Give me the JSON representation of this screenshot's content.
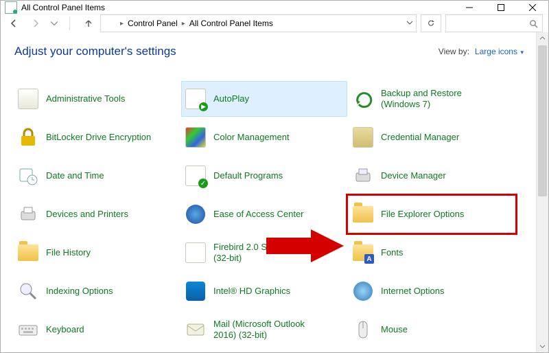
{
  "window": {
    "title": "All Control Panel Items"
  },
  "breadcrumbs": {
    "root": "Control Panel",
    "current": "All Control Panel Items"
  },
  "heading": "Adjust your computer's settings",
  "viewby": {
    "label": "View by:",
    "value": "Large icons"
  },
  "items": [
    {
      "label": "Administrative Tools",
      "icon": "admin-tools-icon"
    },
    {
      "label": "AutoPlay",
      "icon": "autoplay-icon",
      "selected": true
    },
    {
      "label": "Backup and Restore (Windows 7)",
      "icon": "backup-icon",
      "twoline": true
    },
    {
      "label": "BitLocker Drive Encryption",
      "icon": "bitlocker-icon"
    },
    {
      "label": "Color Management",
      "icon": "color-mgmt-icon"
    },
    {
      "label": "Credential Manager",
      "icon": "credential-icon"
    },
    {
      "label": "Date and Time",
      "icon": "date-time-icon"
    },
    {
      "label": "Default Programs",
      "icon": "default-programs-icon"
    },
    {
      "label": "Device Manager",
      "icon": "device-manager-icon"
    },
    {
      "label": "Devices and Printers",
      "icon": "devices-printers-icon"
    },
    {
      "label": "Ease of Access Center",
      "icon": "ease-access-icon"
    },
    {
      "label": "File Explorer Options",
      "icon": "file-explorer-options-icon",
      "highlight": true
    },
    {
      "label": "File History",
      "icon": "file-history-icon"
    },
    {
      "label": "Firebird 2.0 Server Manager (32-bit)",
      "icon": "firebird-icon",
      "twoline": true
    },
    {
      "label": "Fonts",
      "icon": "fonts-icon"
    },
    {
      "label": "Indexing Options",
      "icon": "indexing-icon"
    },
    {
      "label": "Intel® HD Graphics",
      "icon": "intel-hd-icon"
    },
    {
      "label": "Internet Options",
      "icon": "internet-options-icon"
    },
    {
      "label": "Keyboard",
      "icon": "keyboard-icon"
    },
    {
      "label": "Mail (Microsoft Outlook 2016) (32-bit)",
      "icon": "mail-icon",
      "twoline": true
    },
    {
      "label": "Mouse",
      "icon": "mouse-icon"
    }
  ]
}
